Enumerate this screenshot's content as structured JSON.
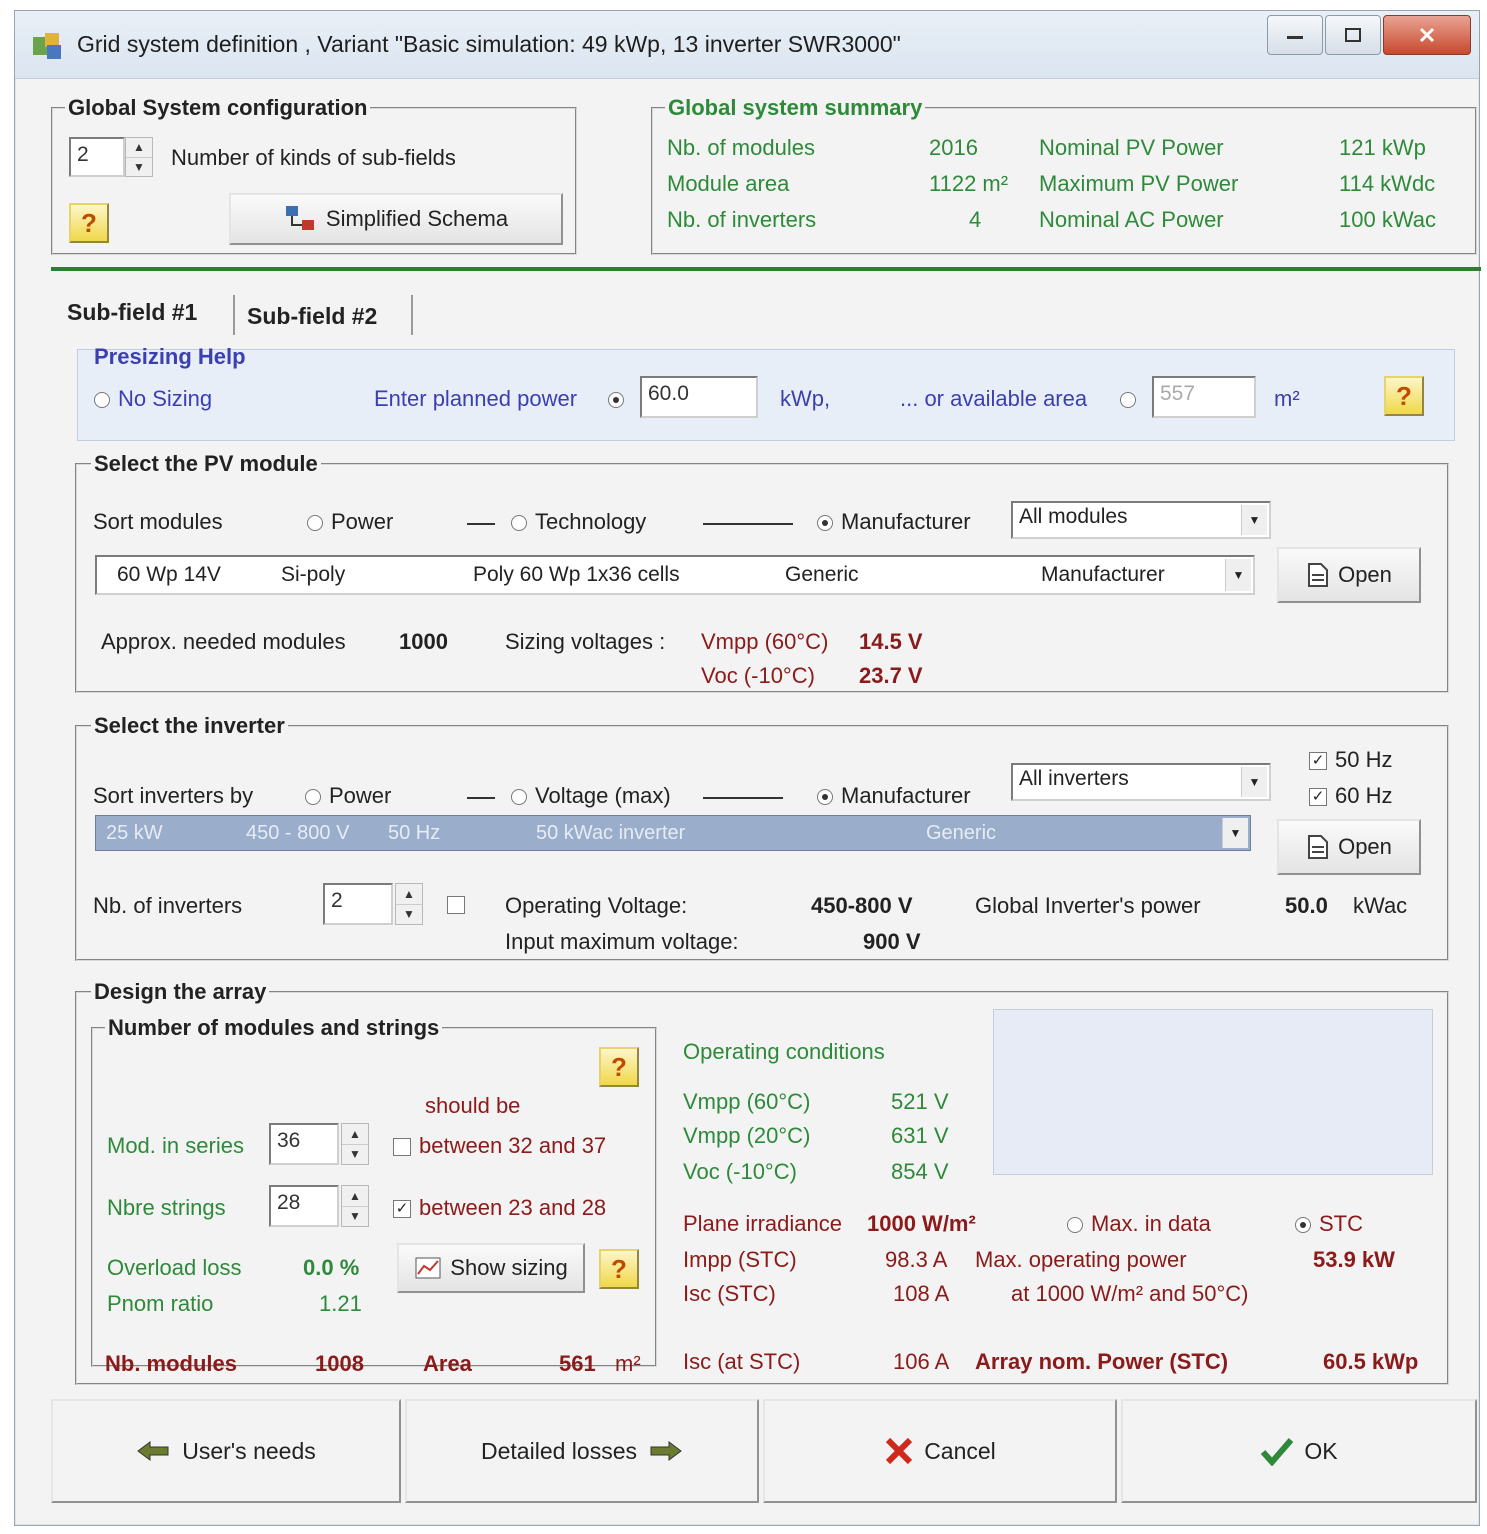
{
  "window": {
    "title": "Grid system definition , Variant  \"Basic simulation: 49 kWp, 13 inverter SWR3000\"",
    "icon": "pvsyst-app-icon",
    "controls": [
      "minimize-icon",
      "maximize-icon",
      "close-icon"
    ]
  },
  "global_config": {
    "title": "Global System configuration",
    "subfields_value": "2",
    "subfields_label": "Number of kinds of sub-fields",
    "simplified_schema": "Simplified Schema",
    "help": "?"
  },
  "summary": {
    "title": "Global system summary",
    "left": [
      {
        "label": "Nb. of modules",
        "value": "2016"
      },
      {
        "label": "Module area",
        "value": "1122 m²"
      },
      {
        "label": "Nb. of inverters",
        "value": "4"
      }
    ],
    "right": [
      {
        "label": "Nominal PV Power",
        "value": "121  kWp"
      },
      {
        "label": "Maximum PV Power",
        "value": "114  kWdc"
      },
      {
        "label": "Nominal AC Power",
        "value": "100  kWac"
      }
    ]
  },
  "tabs": [
    "Sub-field #1",
    "Sub-field #2"
  ],
  "presizing": {
    "title": "Presizing Help",
    "no_sizing": "No Sizing",
    "planned_label": "Enter planned power",
    "planned_value": "60.0",
    "planned_unit": "kWp,",
    "area_label": "... or available area",
    "area_value": "557",
    "area_unit": "m²",
    "help": "?"
  },
  "pv_module": {
    "title": "Select the PV module",
    "sort_label": "Sort modules",
    "sort_power": "Power",
    "sort_tech": "Technology",
    "sort_manuf": "Manufacturer",
    "filter": "All modules",
    "row": [
      "60 Wp 14V",
      "Si-poly",
      "Poly 60 Wp  1x36 cells",
      "Generic",
      "Manufacturer"
    ],
    "open": "Open",
    "approx_label": "Approx. needed modules",
    "approx_value": "1000",
    "sizing_label": "Sizing voltages :",
    "vmpp_label": "Vmpp (60°C)",
    "vmpp_value": "14.5 V",
    "voc_label": "Voc  (-10°C)",
    "voc_value": "23.7 V"
  },
  "inverter": {
    "title": "Select the inverter",
    "sort_label": "Sort inverters by",
    "sort_power": "Power",
    "sort_voltage": "Voltage (max)",
    "sort_manuf": "Manufacturer",
    "filter": "All inverters",
    "hz50": "50 Hz",
    "hz60": "60 Hz",
    "row": [
      "25 kW",
      "450 - 800 V",
      "50 Hz",
      "50 kWac inverter",
      "Generic"
    ],
    "open": "Open",
    "nb_label": "Nb. of inverters",
    "nb_value": "2",
    "op_voltage_label": "Operating Voltage:",
    "op_voltage_value": "450-800 V",
    "input_max_label": "Input maximum voltage:",
    "input_max_value": "900 V",
    "global_power_label": "Global Inverter's power",
    "global_power_value": "50.0",
    "global_power_unit": "kWac"
  },
  "design": {
    "title": "Design the array",
    "sub_title": "Number of modules and strings",
    "should_be": "should be",
    "mod_series_label": "Mod. in series",
    "mod_series_value": "36",
    "mod_series_range": "between 32 and 37",
    "strings_label": "Nbre strings",
    "strings_value": "28",
    "strings_range": "between 23 and 28",
    "overload_label": "Overload loss",
    "overload_value": "0.0 %",
    "pnom_label": "Pnom ratio",
    "pnom_value": "1.21",
    "show_sizing": "Show sizing",
    "nb_modules_label": "Nb. modules",
    "nb_modules_value": "1008",
    "area_label": "Area",
    "area_value": "561",
    "area_unit": "m²",
    "help": "?",
    "op_title": "Operating conditions",
    "vmpp60_label": "Vmpp (60°C)",
    "vmpp60_value": "521 V",
    "vmpp20_label": "Vmpp (20°C)",
    "vmpp20_value": "631 V",
    "voc_label": "Voc  (-10°C)",
    "voc_value": "854 V",
    "irr_label": "Plane irradiance",
    "irr_value": "1000 W/m²",
    "max_in_data": "Max. in data",
    "stc": "STC",
    "impp_label": "Impp (STC)",
    "impp_value": "98.3 A",
    "maxop_label": "Max. operating power",
    "maxop_value": "53.9 kW",
    "isc_label": "Isc  (STC)",
    "isc_value": "108 A",
    "maxop_cond": "at 1000 W/m² and 50°C)",
    "isc_at_label": "Isc (at STC)",
    "isc_at_value": "106 A",
    "array_nom_label": "Array nom. Power (STC)",
    "array_nom_value": "60.5 kWp"
  },
  "footer": {
    "users_needs": "User's needs",
    "detailed_losses": "Detailed losses",
    "cancel": "Cancel",
    "ok": "OK"
  }
}
